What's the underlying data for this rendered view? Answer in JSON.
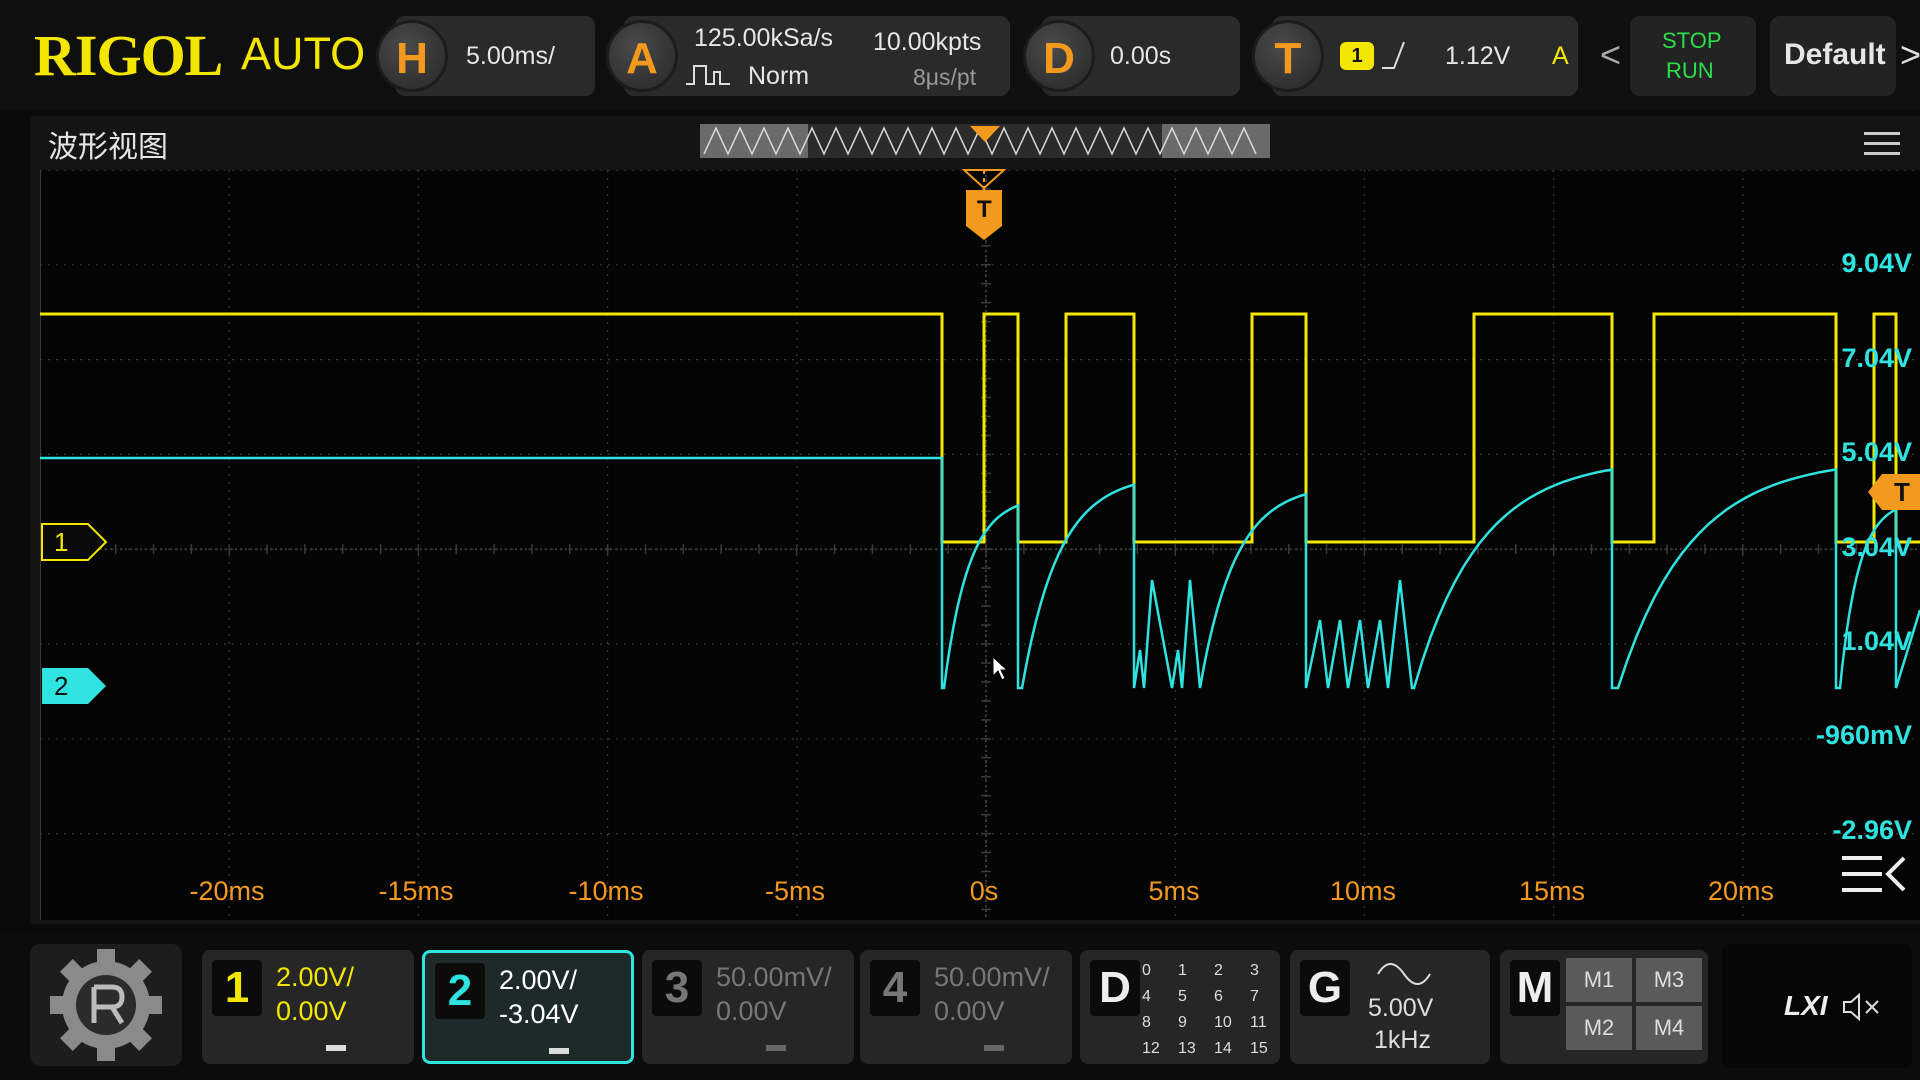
{
  "topbar": {
    "brand": "RIGOL",
    "mode": "AUTO",
    "horizontal": {
      "key": "H",
      "timebase": "5.00ms/"
    },
    "acquire": {
      "key": "A",
      "sample_rate": "125.00kSa/s",
      "points": "10.00kpts",
      "acq_mode": "Norm",
      "time_per_point": "8μs/pt"
    },
    "delay": {
      "key": "D",
      "value": "0.00s"
    },
    "trigger": {
      "key": "T",
      "source": "1",
      "level": "1.12V",
      "sweep": "A"
    },
    "stop_run": {
      "line1": "STOP",
      "line2": "RUN"
    },
    "default_label": "Default",
    "nav_prev": "<",
    "nav_next": ">"
  },
  "view": {
    "title": "波形视图",
    "trigger_marker": "T",
    "ch1_marker": "1",
    "ch2_marker": "2",
    "right_trigger_marker": "T",
    "voltage_labels": [
      "9.04V",
      "7.04V",
      "5.04V",
      "3.04V",
      "1.04V",
      "-960mV",
      "-2.96V"
    ],
    "time_labels": [
      "-20ms",
      "-15ms",
      "-10ms",
      "-5ms",
      "0s",
      "5ms",
      "10ms",
      "15ms",
      "20ms"
    ]
  },
  "colors": {
    "ch1": "#f3e600",
    "ch2": "#2fe3e0",
    "trigger": "#f39a1e",
    "grid": "#3a3a3a",
    "run": "#29e04a"
  },
  "channels": [
    {
      "num": "1",
      "scale": "2.00V/",
      "offset": "0.00V",
      "active": true
    },
    {
      "num": "2",
      "scale": "2.00V/",
      "offset": "-3.04V",
      "active": true,
      "selected": true
    },
    {
      "num": "3",
      "scale": "50.00mV/",
      "offset": "0.00V",
      "active": false
    },
    {
      "num": "4",
      "scale": "50.00mV/",
      "offset": "0.00V",
      "active": false
    }
  ],
  "digital": {
    "key": "D",
    "bits": [
      "0",
      "1",
      "2",
      "3",
      "4",
      "5",
      "6",
      "7",
      "8",
      "9",
      "10",
      "11",
      "12",
      "13",
      "14",
      "15"
    ]
  },
  "generator": {
    "key": "G",
    "amplitude": "5.00V",
    "frequency": "1kHz"
  },
  "math": {
    "key": "M",
    "items": [
      "M1",
      "M3",
      "M2",
      "M4"
    ]
  },
  "status": {
    "lxi": "LXI",
    "mute_icon": "speaker-mute-icon"
  }
}
